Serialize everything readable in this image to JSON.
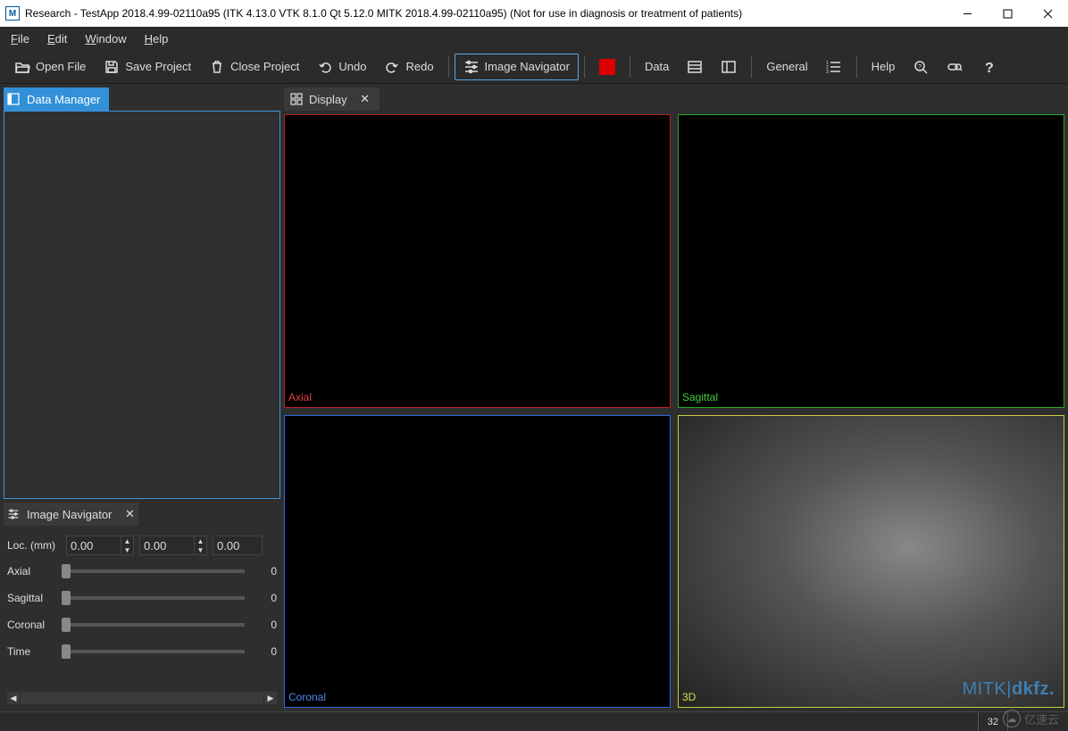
{
  "titlebar": {
    "icon_label": "M",
    "title": "Research - TestApp 2018.4.99-02110a95 (ITK 4.13.0  VTK 8.1.0 Qt 5.12.0 MITK 2018.4.99-02110a95) (Not for use in diagnosis or treatment of patients)"
  },
  "menubar": {
    "file": "File",
    "edit": "Edit",
    "window": "Window",
    "help": "Help"
  },
  "toolbar": {
    "open_file": "Open File",
    "save_project": "Save Project",
    "close_project": "Close Project",
    "undo": "Undo",
    "redo": "Redo",
    "image_navigator": "Image Navigator",
    "data": "Data",
    "general": "General",
    "help": "Help"
  },
  "panels": {
    "data_manager": {
      "label": "Data Manager"
    },
    "image_navigator": {
      "label": "Image Navigator"
    },
    "display": {
      "label": "Display"
    }
  },
  "image_nav": {
    "loc_label": "Loc. (mm)",
    "loc_x": "0.00",
    "loc_y": "0.00",
    "loc_z": "0.00",
    "sliders": [
      {
        "label": "Axial",
        "value": "0"
      },
      {
        "label": "Sagittal",
        "value": "0"
      },
      {
        "label": "Coronal",
        "value": "0"
      },
      {
        "label": "Time",
        "value": "0"
      }
    ]
  },
  "views": {
    "axial": "Axial",
    "sagittal": "Sagittal",
    "coronal": "Coronal",
    "threed": "3D",
    "logo_mitk": "MITK",
    "logo_dkfz": "dkfz."
  },
  "statusbar": {
    "right": "32"
  },
  "watermark": {
    "text": "亿速云"
  }
}
